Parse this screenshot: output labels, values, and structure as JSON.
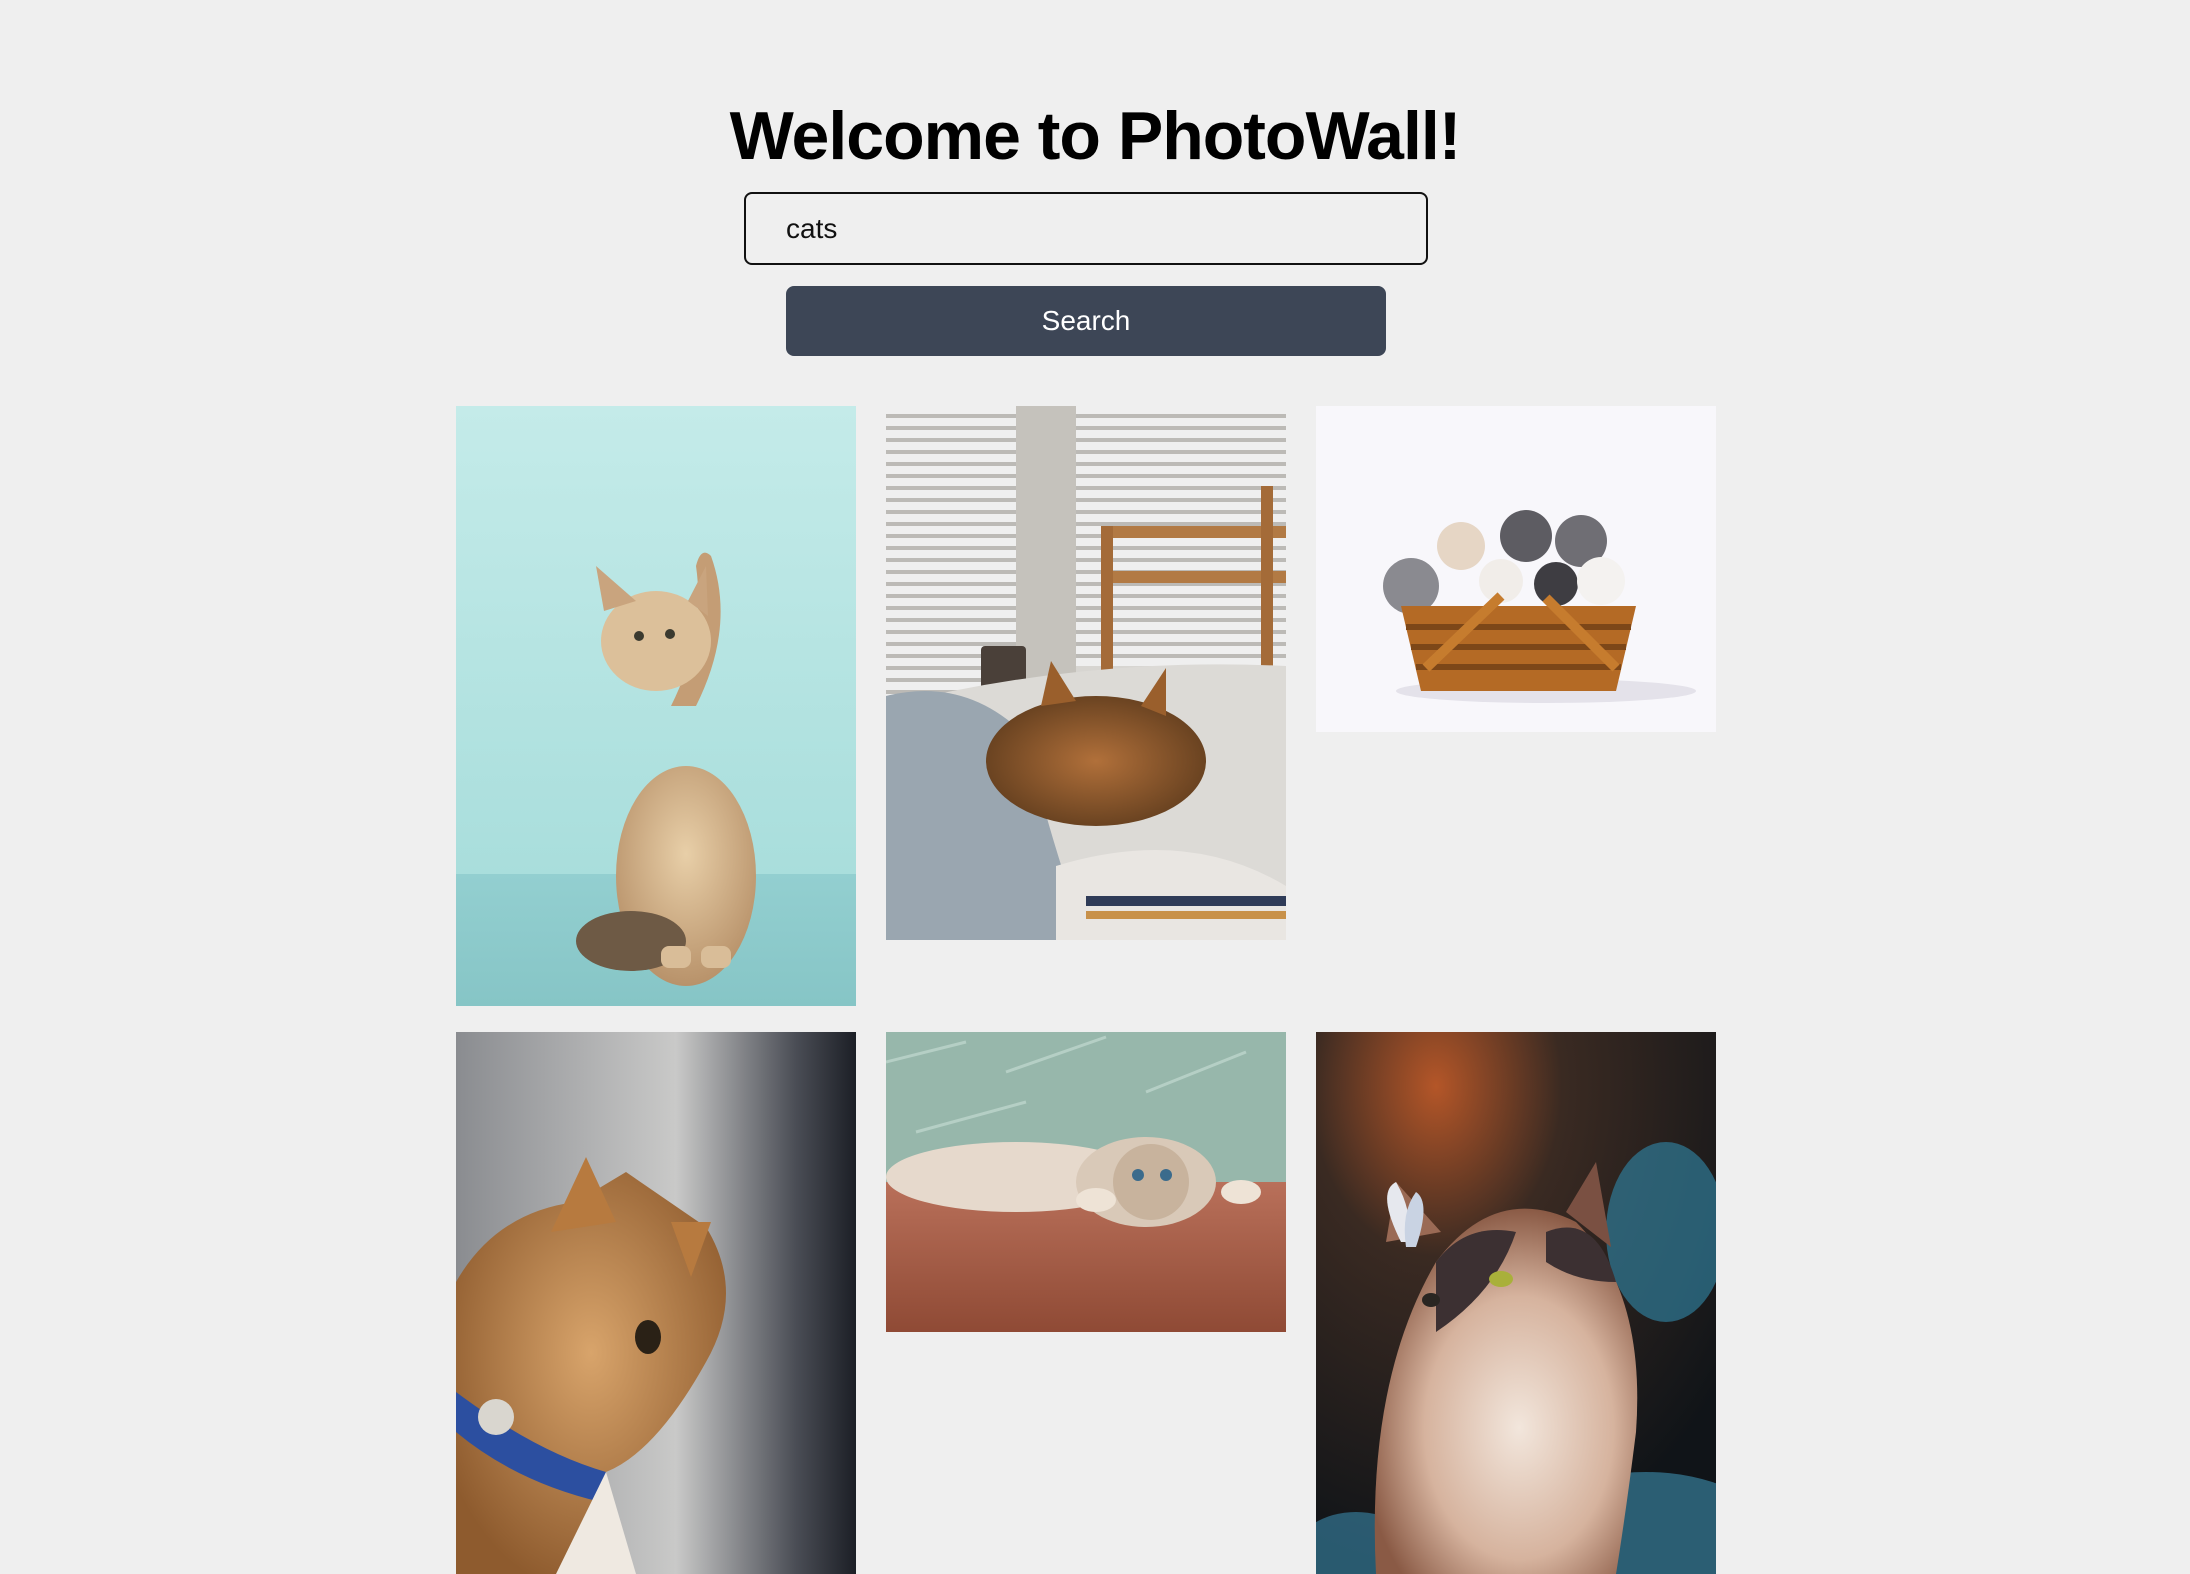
{
  "header": {
    "title": "Welcome to PhotoWall!"
  },
  "search": {
    "value": "cats",
    "button_label": "Search"
  },
  "gallery": {
    "photos": [
      {
        "subject": "kitten-raising-paw",
        "background": "#bfe6e4"
      },
      {
        "subject": "cat-sleeping-on-bed",
        "background": "#c9c6c2"
      },
      {
        "subject": "kittens-in-basket",
        "background": "#f7f6fa"
      },
      {
        "subject": "ginger-cat-with-collar",
        "background": "#55585c"
      },
      {
        "subject": "cat-lying-on-floor",
        "background": "#a5604a"
      },
      {
        "subject": "fluffy-cat-with-butterfly",
        "background": "#2a2420"
      }
    ]
  }
}
